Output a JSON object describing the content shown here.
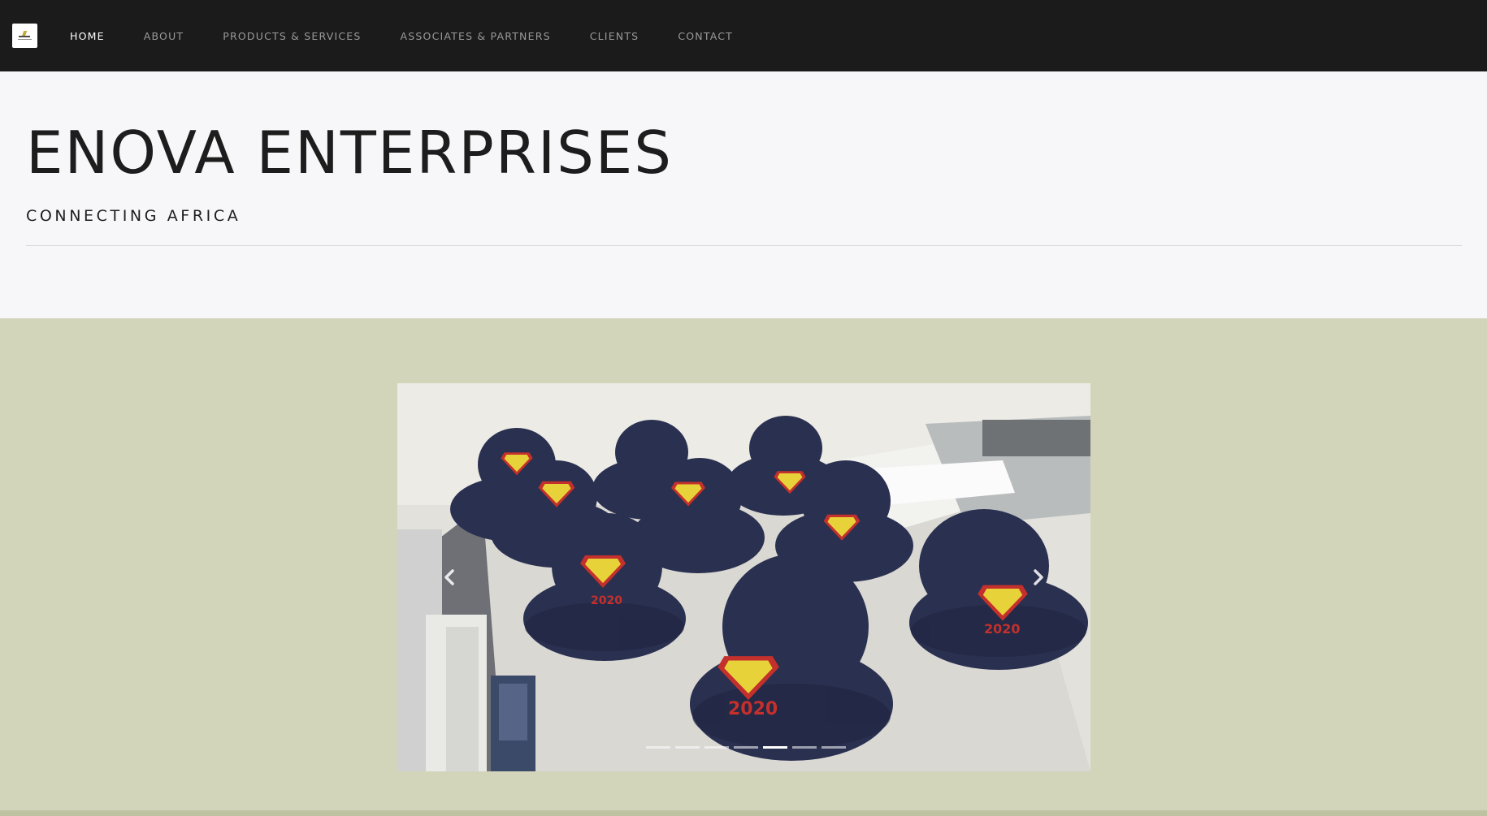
{
  "nav": {
    "logo_icon": "enova-logo-icon",
    "links": [
      {
        "label": "HOME",
        "active": true
      },
      {
        "label": "ABOUT",
        "active": false
      },
      {
        "label": "PRODUCTS & SERVICES",
        "active": false
      },
      {
        "label": "ASSOCIATES & PARTNERS",
        "active": false
      },
      {
        "label": "CLIENTS",
        "active": false
      },
      {
        "label": "CONTACT",
        "active": false
      }
    ]
  },
  "hero": {
    "title": "ENOVA ENTERPRISES",
    "tagline": "CONNECTING AFRICA"
  },
  "carousel": {
    "slide_count": 7,
    "active_index": 4,
    "prev_icon": "chevron-left-icon",
    "next_icon": "chevron-right-icon",
    "hat_emblem_text": "2020"
  },
  "colors": {
    "navbar_bg": "#1b1b1c",
    "hero_bg": "#f7f7f9",
    "band_bg": "#d3d5bb",
    "nav_active": "#ffffff",
    "nav_inactive": "#9a9a9a",
    "hat_navy": "#2a3050",
    "emblem_yellow": "#e8d23a",
    "emblem_red": "#c4302b"
  }
}
